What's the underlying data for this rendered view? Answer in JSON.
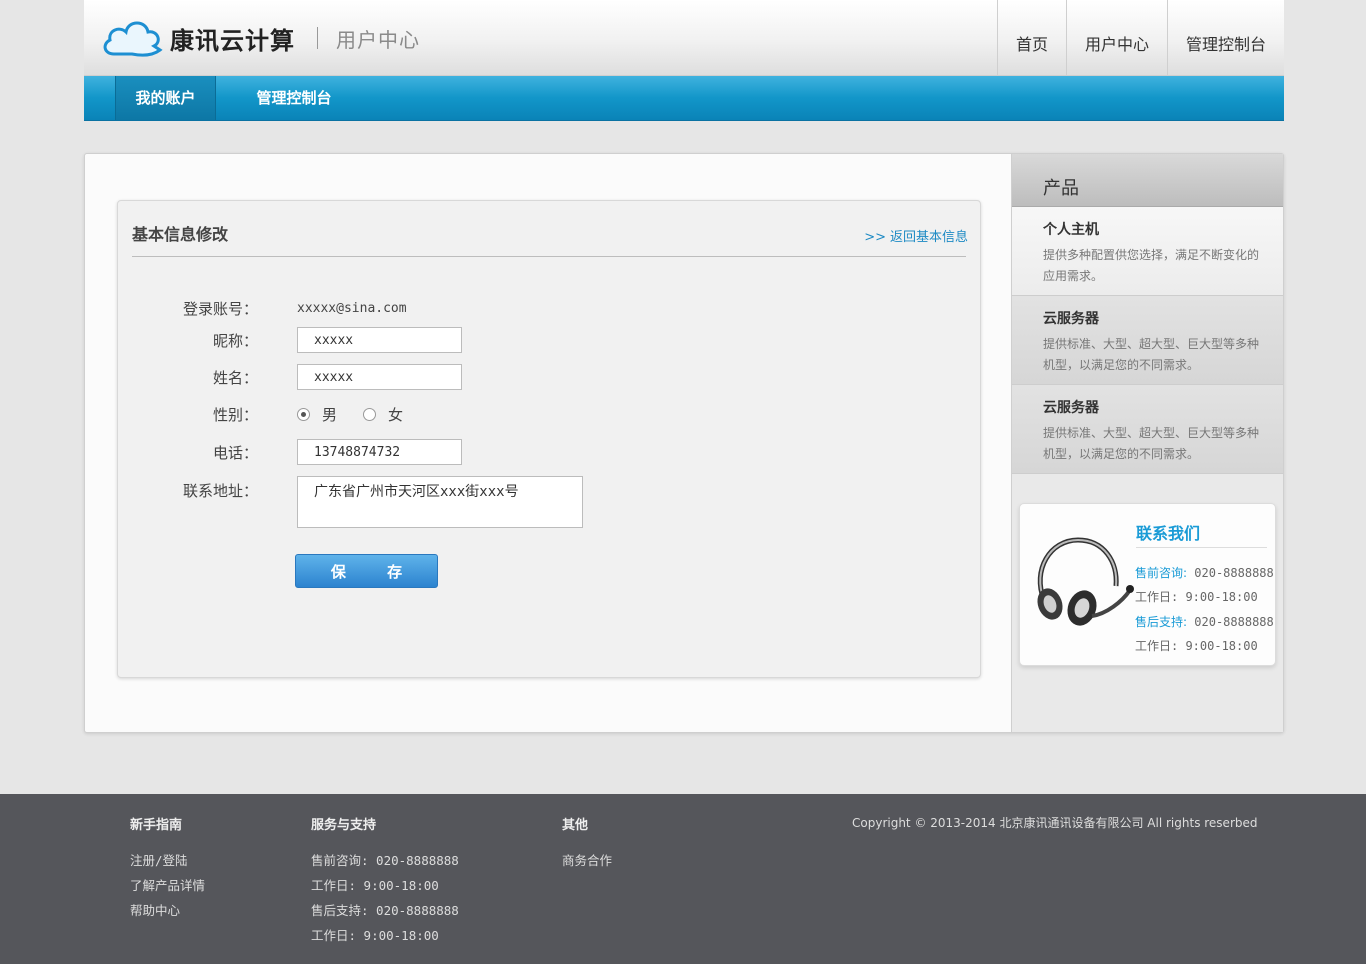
{
  "header": {
    "brand": "康讯云计算",
    "subtitle": "用户中心",
    "nav": [
      "首页",
      "用户中心",
      "管理控制台"
    ]
  },
  "menu": {
    "active": "我的账户",
    "console": "管理控制台"
  },
  "form": {
    "title": "基本信息修改",
    "back_link": "返回基本信息",
    "login_label": "登录账号：",
    "login_value": "xxxxx@sina.com",
    "nickname_label": "昵称：",
    "nickname_value": "xxxxx",
    "name_label": "姓名：",
    "name_value": "xxxxx",
    "gender_label": "性别：",
    "gender_options": [
      "男",
      "女"
    ],
    "gender_selected": "男",
    "phone_label": "电话：",
    "phone_value": "13748874732",
    "address_label": "联系地址：",
    "address_value": "广东省广州市天河区xxx街xxx号",
    "save_label": "保 存"
  },
  "sidebar": {
    "title": "产品",
    "products": [
      {
        "title": "个人主机",
        "desc": "提供多种配置供您选择，满足不断变化的应用需求。"
      },
      {
        "title": "云服务器",
        "desc": "提供标准、大型、超大型、巨大型等多种机型，以满足您的不同需求。"
      },
      {
        "title": "云服务器",
        "desc": "提供标准、大型、超大型、巨大型等多种机型，以满足您的不同需求。"
      }
    ],
    "contact": {
      "title": "联系我们",
      "presale_label": "售前咨询:",
      "presale_phone": "020-8888888",
      "hours1": "工作日: 9:00-18:00",
      "support_label": "售后支持:",
      "support_phone": "020-8888888",
      "hours2": "工作日: 9:00-18:00"
    }
  },
  "footer": {
    "col1": {
      "title": "新手指南",
      "links": [
        "注册/登陆",
        "了解产品详情",
        "帮助中心"
      ]
    },
    "col2": {
      "title": "服务与支持",
      "links": [
        "售前咨询: 020-8888888",
        "工作日: 9:00-18:00",
        "售后支持: 020-8888888",
        "工作日: 9:00-18:00"
      ]
    },
    "col3": {
      "title": "其他",
      "links": [
        "商务合作"
      ]
    },
    "copyright": "Copyright © 2013-2014 北京康讯通讯设备有限公司 All rights reserbed"
  },
  "colors": {
    "accent_blue": "#1296c9",
    "link_blue": "#1d8ac4",
    "footer_bg": "#55565b"
  }
}
